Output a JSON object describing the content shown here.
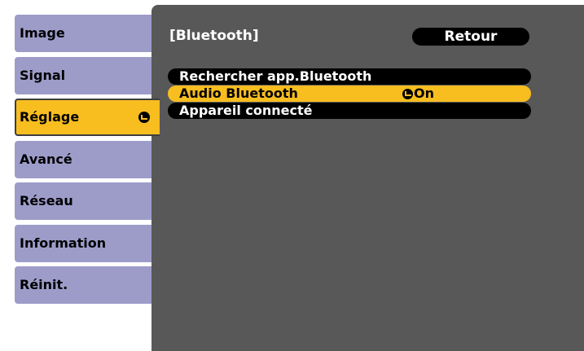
{
  "side_menu": {
    "items": [
      {
        "label": "Image"
      },
      {
        "label": "Signal"
      },
      {
        "label": "Réglage"
      },
      {
        "label": "Avancé"
      },
      {
        "label": "Réseau"
      },
      {
        "label": "Information"
      },
      {
        "label": "Réinit."
      }
    ],
    "active_index": 2,
    "active_icon": "enter-icon"
  },
  "panel": {
    "title": "[Bluetooth]",
    "back_label": "Retour",
    "options": [
      {
        "label": "Rechercher app.Bluetooth",
        "value": ""
      },
      {
        "label": "Audio Bluetooth",
        "value": "On",
        "value_icon": "check-icon"
      },
      {
        "label": "Appareil connecté",
        "value": ""
      }
    ],
    "selected_index": 1
  },
  "colors": {
    "menu_tab": "#9d9cc9",
    "highlight": "#f8bd1f",
    "panel_bg": "#585858",
    "pill_bg": "#000000",
    "text_light": "#ffffff"
  }
}
